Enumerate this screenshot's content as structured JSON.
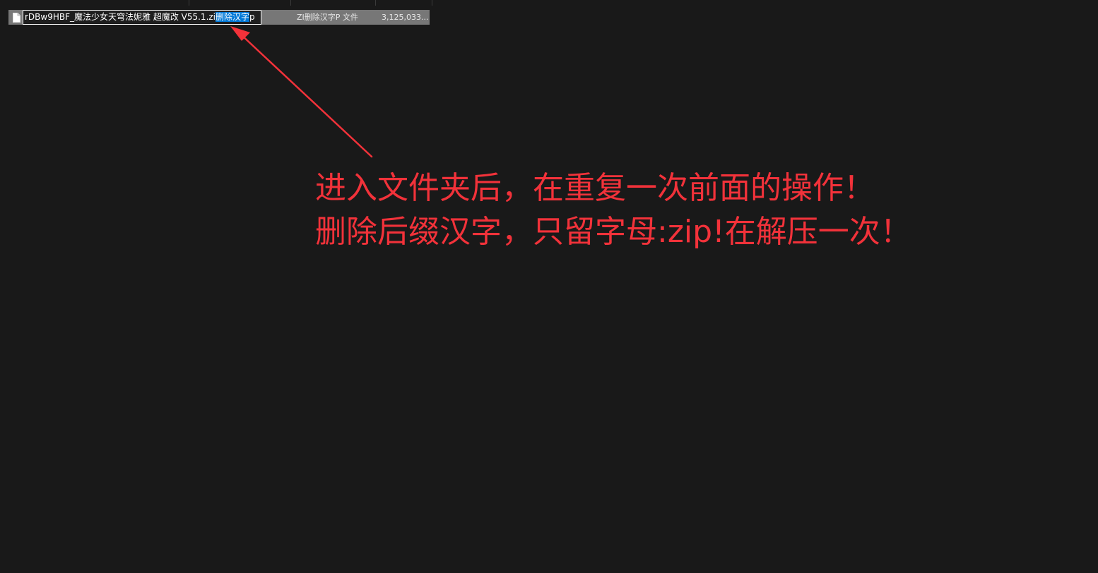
{
  "file_row": {
    "name_prefix": "rDBw9HBF_魔法少女天穹法妮雅 超魔改 V55.1.zi",
    "name_selected": "删除汉字",
    "name_suffix": "p",
    "type": "ZI删除汉字P 文件",
    "size": "3,125,033..."
  },
  "icons": {
    "file": "file-icon"
  },
  "annotation": {
    "line1": "进入文件夹后，在重复一次前面的操作！",
    "line2": "删除后缀汉字，只留字母:zip!在解压一次！"
  },
  "colors": {
    "background": "#191919",
    "selection": "#0078d7",
    "annotation": "#f2323a",
    "row_highlight": "#777777"
  }
}
